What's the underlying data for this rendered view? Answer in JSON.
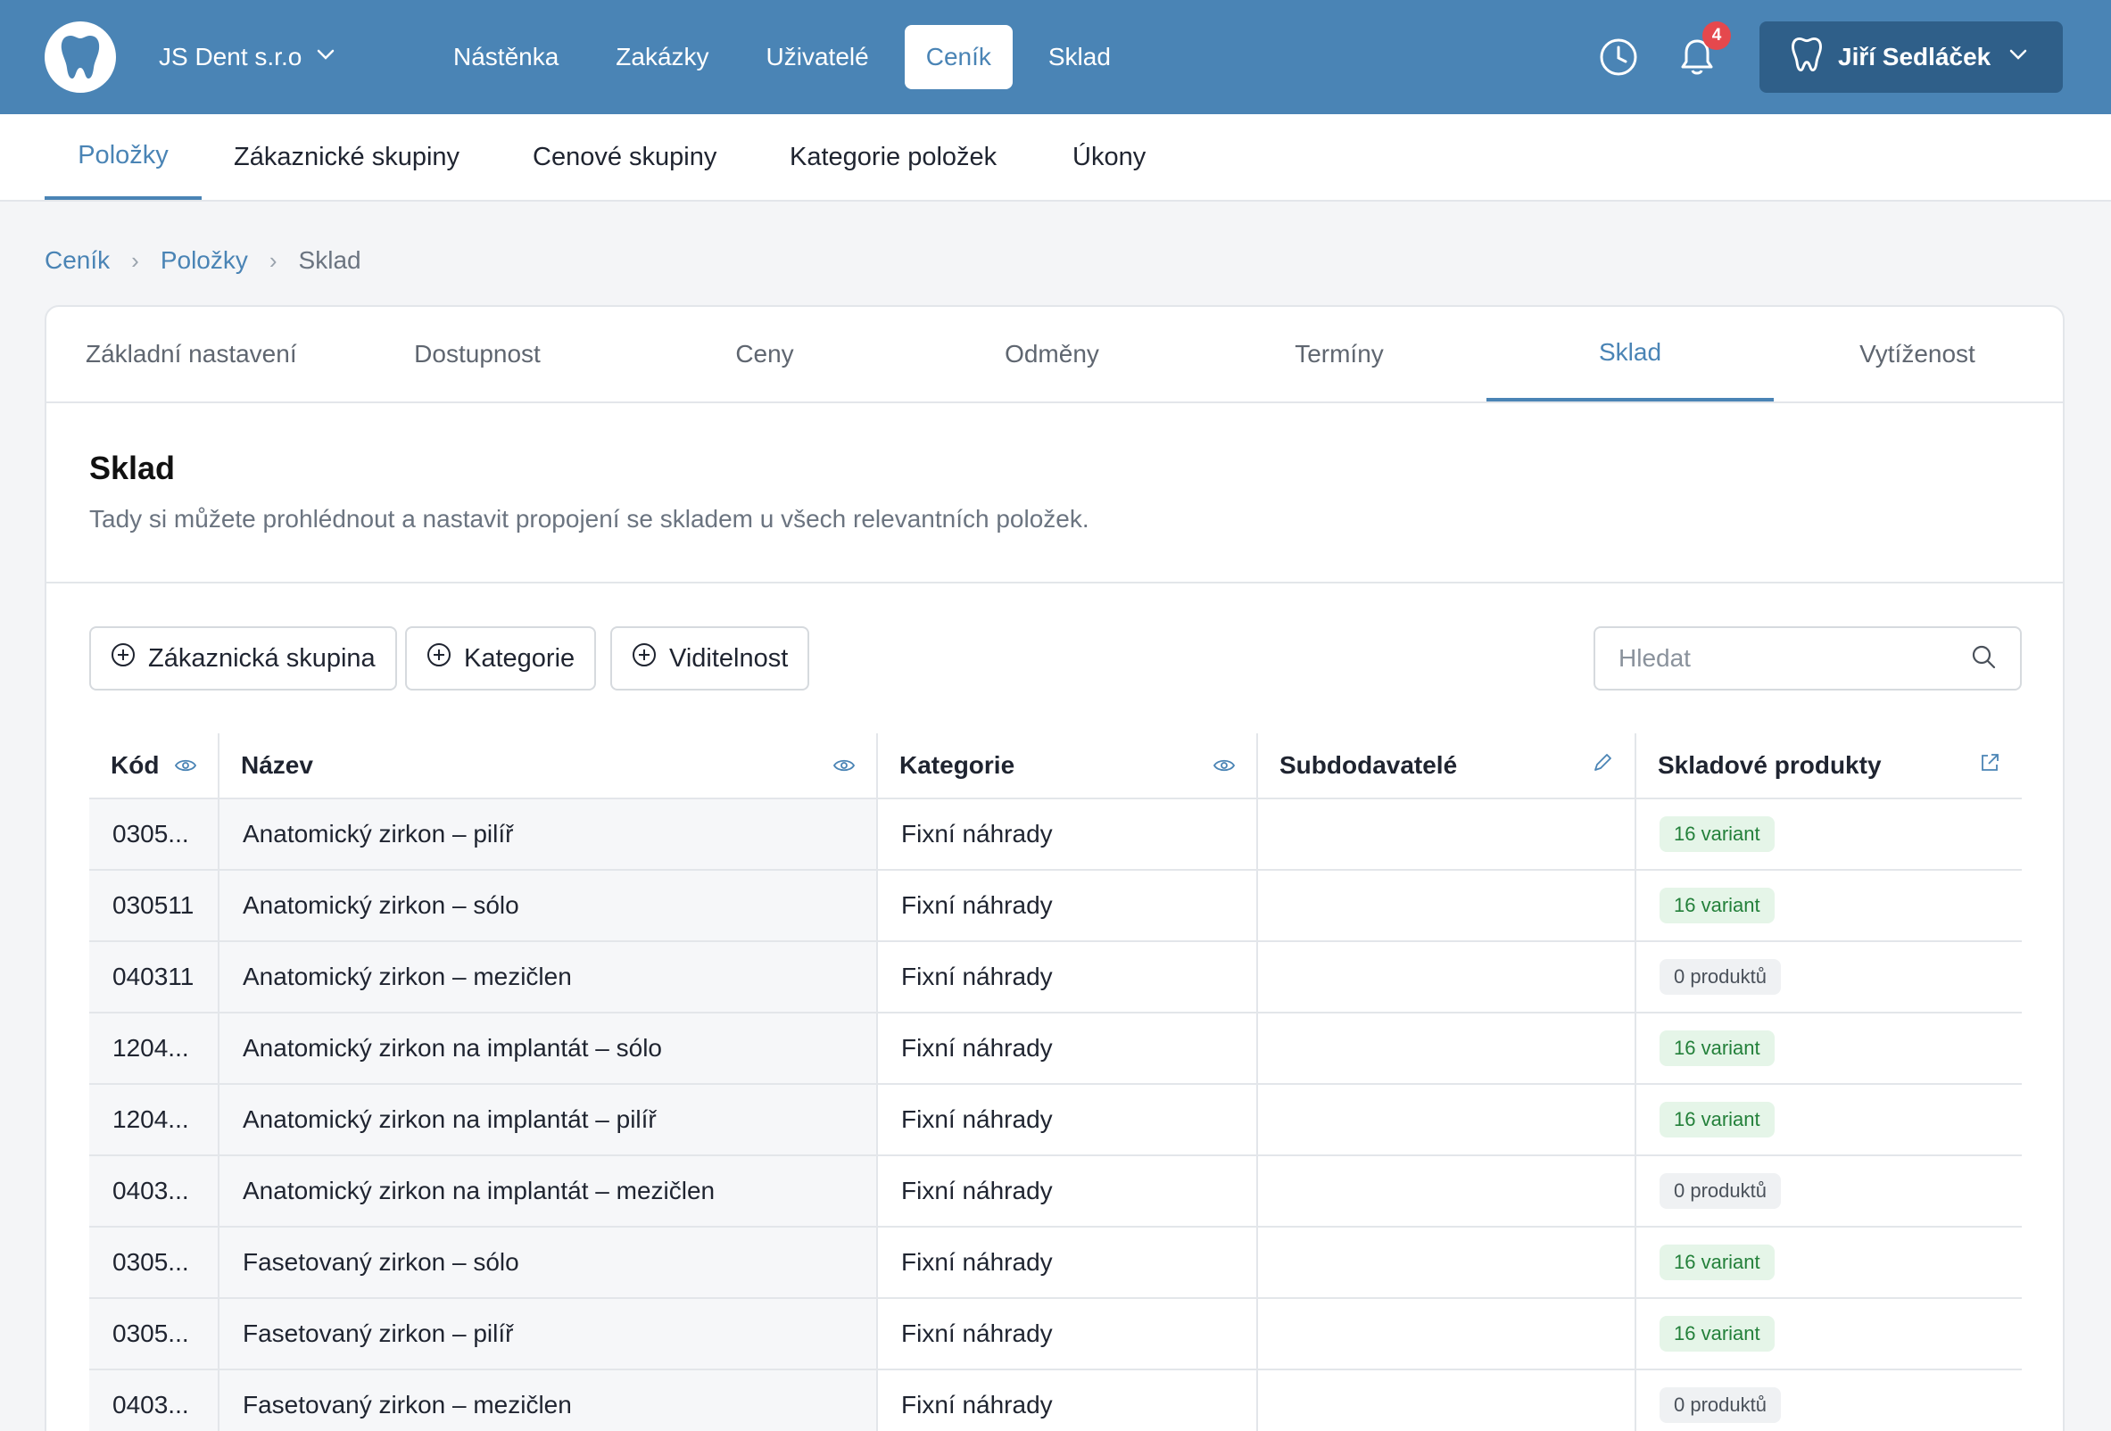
{
  "header": {
    "company": "JS Dent s.r.o",
    "nav": [
      "Nástěnka",
      "Zakázky",
      "Uživatelé",
      "Ceník",
      "Sklad"
    ],
    "active_nav": "Ceník",
    "notification_count": "4",
    "user_name": "Jiří Sedláček",
    "accent_color": "#4a84b5"
  },
  "subnav": {
    "items": [
      "Položky",
      "Zákaznické skupiny",
      "Cenové skupiny",
      "Kategorie položek",
      "Úkony"
    ],
    "active": "Položky"
  },
  "breadcrumb": [
    "Ceník",
    "Položky",
    "Sklad"
  ],
  "tabs": {
    "items": [
      "Základní nastavení",
      "Dostupnost",
      "Ceny",
      "Odměny",
      "Termíny",
      "Sklad",
      "Vytíženost"
    ],
    "active": "Sklad"
  },
  "section": {
    "title": "Sklad",
    "description": "Tady si můžete prohlédnout a nastavit propojení se skladem u všech relevantních položek."
  },
  "filters": [
    "Zákaznická skupina",
    "Kategorie",
    "Viditelnost"
  ],
  "search": {
    "placeholder": "Hledat",
    "value": ""
  },
  "table": {
    "columns": [
      "Kód",
      "Název",
      "Kategorie",
      "Subdodavatelé",
      "Skladové produkty"
    ],
    "rows": [
      {
        "kod": "0305...",
        "nazev": "Anatomický zirkon – pilíř",
        "kategorie": "Fixní náhrady",
        "subdodavatele": "",
        "sklad": "16 variant",
        "status": "green"
      },
      {
        "kod": "030511",
        "nazev": "Anatomický zirkon – sólo",
        "kategorie": "Fixní náhrady",
        "subdodavatele": "",
        "sklad": "16 variant",
        "status": "green"
      },
      {
        "kod": "040311",
        "nazev": "Anatomický zirkon – mezičlen",
        "kategorie": "Fixní náhrady",
        "subdodavatele": "",
        "sklad": "0 produktů",
        "status": "gray"
      },
      {
        "kod": "1204...",
        "nazev": "Anatomický zirkon na implantát – sólo",
        "kategorie": "Fixní náhrady",
        "subdodavatele": "",
        "sklad": "16 variant",
        "status": "green"
      },
      {
        "kod": "1204...",
        "nazev": "Anatomický zirkon na implantát – pilíř",
        "kategorie": "Fixní náhrady",
        "subdodavatele": "",
        "sklad": "16 variant",
        "status": "green"
      },
      {
        "kod": "0403...",
        "nazev": "Anatomický zirkon na implantát – mezičlen",
        "kategorie": "Fixní náhrady",
        "subdodavatele": "",
        "sklad": "0 produktů",
        "status": "gray"
      },
      {
        "kod": "0305...",
        "nazev": "Fasetovaný zirkon – sólo",
        "kategorie": "Fixní náhrady",
        "subdodavatele": "",
        "sklad": "16 variant",
        "status": "green"
      },
      {
        "kod": "0305...",
        "nazev": "Fasetovaný zirkon – pilíř",
        "kategorie": "Fixní náhrady",
        "subdodavatele": "",
        "sklad": "16 variant",
        "status": "green"
      },
      {
        "kod": "0403...",
        "nazev": "Fasetovaný zirkon – mezičlen",
        "kategorie": "Fixní náhrady",
        "subdodavatele": "",
        "sklad": "0 produktů",
        "status": "gray"
      }
    ]
  },
  "icons": {
    "logo": "tooth-icon",
    "company_dropdown": "chevron-down-icon",
    "history": "clock-icon",
    "notifications": "bell-icon",
    "user": "tooth-outline-icon",
    "filter_add": "plus-circle-icon",
    "search": "search-icon",
    "column_visibility": "eye-icon",
    "column_edit": "pencil-icon",
    "column_external": "external-link-icon"
  }
}
